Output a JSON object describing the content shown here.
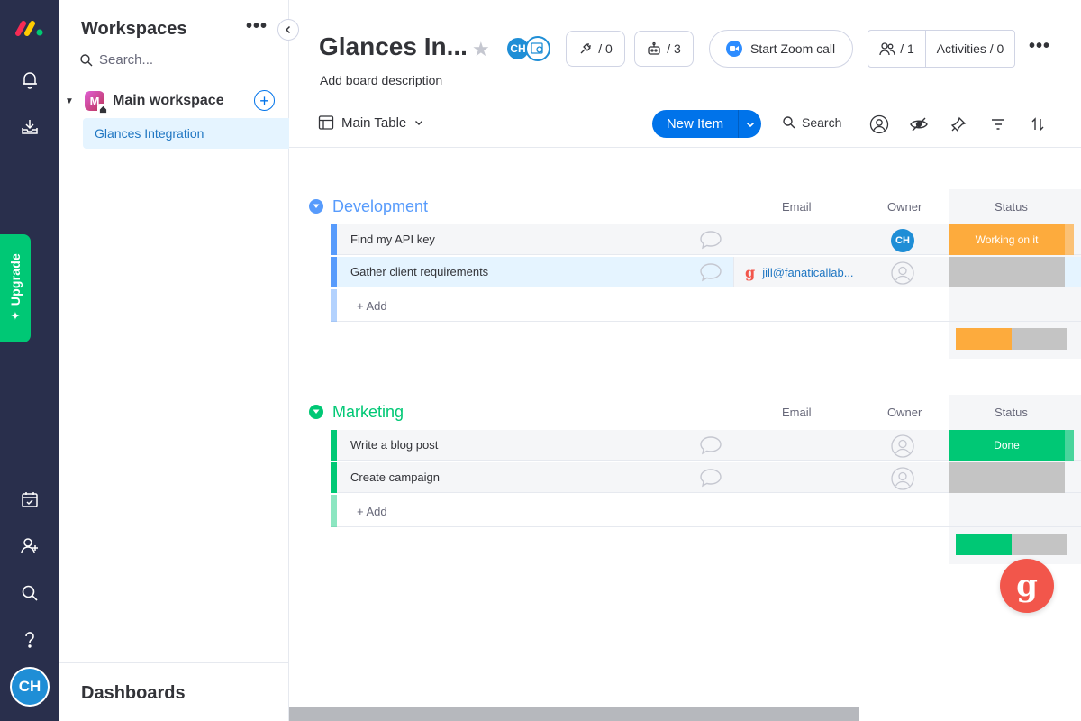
{
  "colors": {
    "rail": "#292f4c",
    "upgrade": "#00c875",
    "primary": "#0073ea",
    "development": "#579bfc",
    "marketing": "#00c875",
    "working_on_it": "#fdab3d",
    "done": "#00c875",
    "empty_status": "#c4c4c4",
    "fab": "#f2564b"
  },
  "rail": {
    "upgrade_label": "Upgrade",
    "avatar_initials": "CH",
    "icons": [
      "monday-logo-icon",
      "bell-icon",
      "inbox-icon",
      "calendar-check-icon",
      "invite-user-icon",
      "search-icon",
      "help-icon"
    ]
  },
  "workspace": {
    "title": "Workspaces",
    "more": "•••",
    "search_placeholder": "Search...",
    "main_name": "Main workspace",
    "main_initial": "M",
    "board_name": "Glances Integration",
    "bottom_title": "Dashboards"
  },
  "board": {
    "title": "Glances In...",
    "description": "Add board description",
    "avatar_initials": "CH",
    "integrations_count": "/ 0",
    "automations_count": "/ 3",
    "zoom_label": "Start Zoom call",
    "people_count": "/ 1",
    "activities_label": "Activities / 0",
    "more": "•••"
  },
  "toolbar": {
    "view_label": "Main Table",
    "new_item_label": "New Item",
    "search_label": "Search"
  },
  "columns": {
    "email": "Email",
    "owner": "Owner",
    "status": "Status"
  },
  "groups": [
    {
      "name": "Development",
      "color": "#579bfc",
      "add_label": "+ Add",
      "items": [
        {
          "name": "Find my API key",
          "email": "",
          "owner": "CH",
          "status": "Working on it",
          "status_color": "#fdab3d"
        },
        {
          "name": "Gather client requirements",
          "email": "jill@fanaticallab...",
          "owner": "",
          "status": "",
          "status_color": "#c4c4c4"
        }
      ],
      "summary": {
        "filled_fraction": 0.5,
        "filled_color": "#fdab3d"
      }
    },
    {
      "name": "Marketing",
      "color": "#00c875",
      "add_label": "+ Add",
      "items": [
        {
          "name": "Write a blog post",
          "email": "",
          "owner": "",
          "status": "Done",
          "status_color": "#00c875"
        },
        {
          "name": "Create campaign",
          "email": "",
          "owner": "",
          "status": "",
          "status_color": "#c4c4c4"
        }
      ],
      "summary": {
        "filled_fraction": 0.5,
        "filled_color": "#00c875"
      }
    }
  ],
  "fab": {
    "glyph": "g",
    "icon": "glances-icon"
  }
}
